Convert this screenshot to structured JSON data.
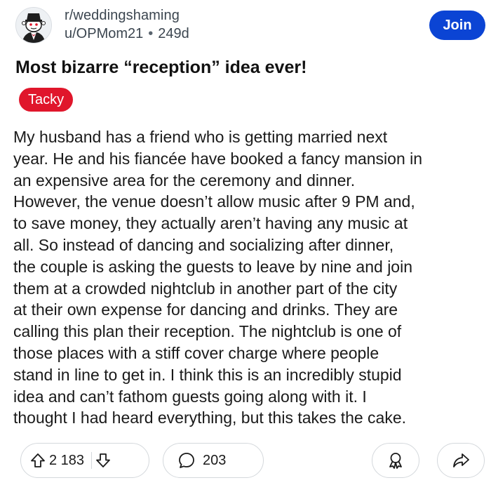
{
  "post": {
    "subreddit": "r/weddingshaming",
    "author": "u/OPMom21",
    "separator": "•",
    "age": "249d",
    "join_label": "Join",
    "title": "Most bizarre “reception” idea ever!",
    "flair": "Tacky",
    "body_lines": [
      "My husband has a friend who is getting married next",
      "year. He and his fiancée have booked a fancy mansion in",
      "an expensive area for the ceremony and dinner.",
      "However, the venue doesn’t allow music after 9 PM and,",
      "to save money, they actually aren’t having any music at",
      "all.  So instead of dancing and socializing after dinner,",
      "the couple is asking the guests to leave by nine and join",
      "them at a crowded nightclub in another part of the city",
      "at their own expense for dancing and drinks. They are",
      "calling this plan their reception. The nightclub is one of",
      "those places with a stiff cover charge  where people",
      "stand in line to get in. I think this is an incredibly stupid",
      "idea and can’t fathom guests going along with it. I",
      "thought I had heard everything, but this takes the cake."
    ]
  },
  "actions": {
    "score": "2 183",
    "comments": "203"
  },
  "colors": {
    "join_button": "#0b44d4",
    "flair_background": "#e0162b",
    "meta_text": "#3c4650",
    "border": "#d4d8dc"
  },
  "icons": {
    "subreddit_avatar": "tuxedo-bride-avatar-icon",
    "upvote": "arrow-up-icon",
    "downvote": "arrow-down-icon",
    "comments": "speech-bubble-icon",
    "award": "award-ribbon-icon",
    "share": "share-arrow-icon"
  }
}
